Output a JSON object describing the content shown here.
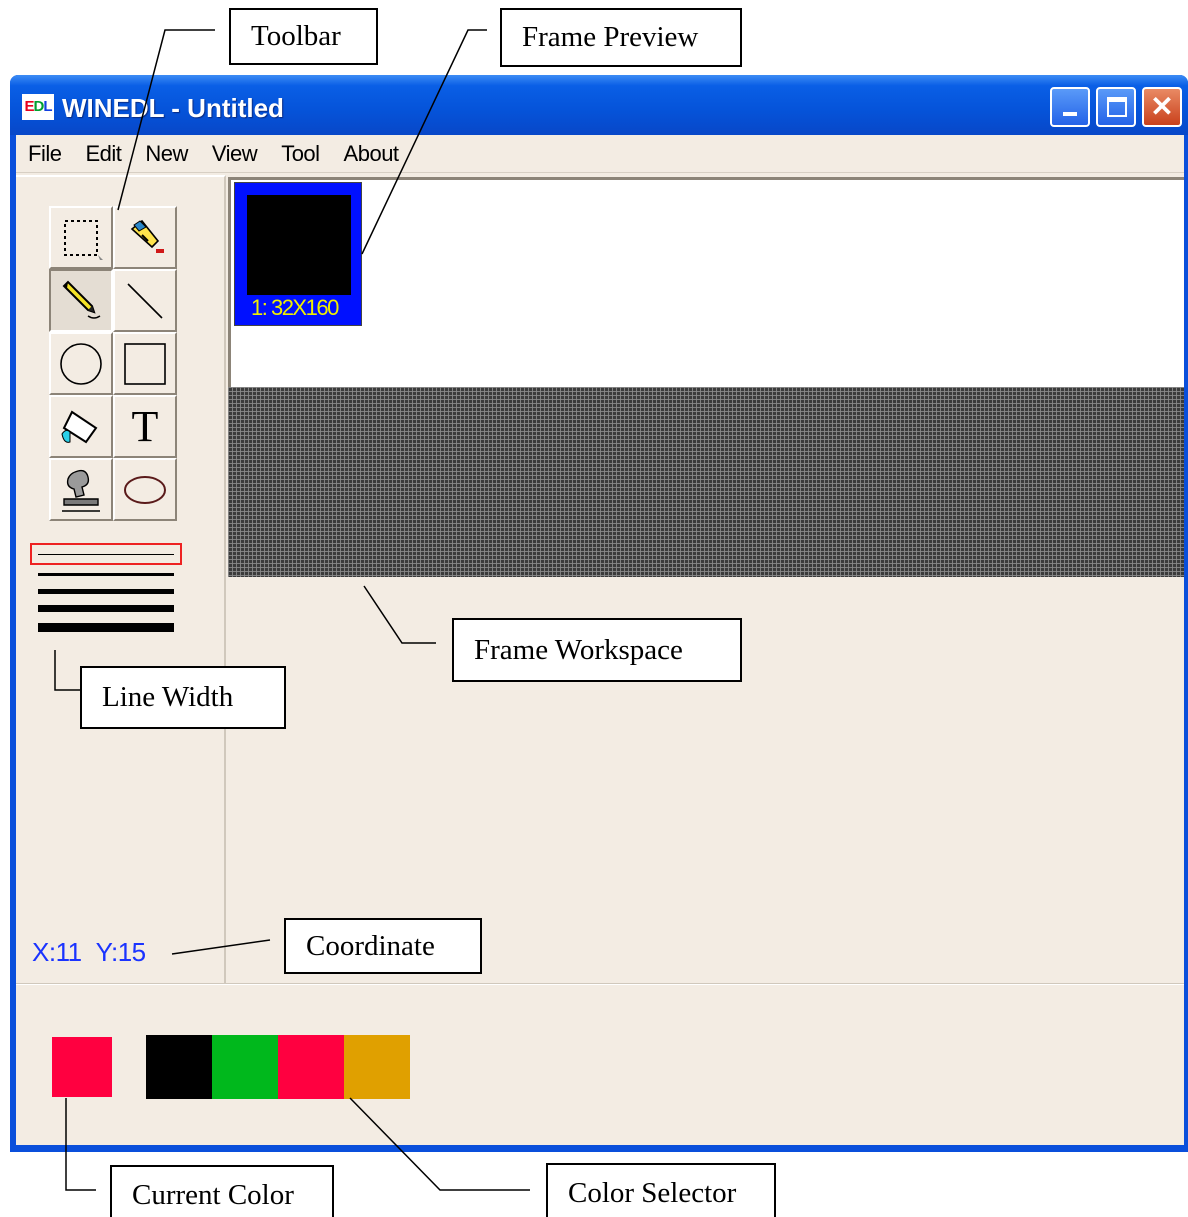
{
  "window": {
    "title": "WINEDL - Untitled",
    "icon_text": [
      "E",
      "D",
      "L"
    ]
  },
  "menu": [
    "File",
    "Edit",
    "New",
    "View",
    "Tool",
    "About"
  ],
  "tools": [
    {
      "name": "select-rect-tool",
      "icon": "dotted-rectangle"
    },
    {
      "name": "pick-color-tool",
      "icon": "dropper"
    },
    {
      "name": "pencil-tool",
      "icon": "pencil",
      "active": true
    },
    {
      "name": "line-tool",
      "icon": "diagonal-line"
    },
    {
      "name": "circle-tool",
      "icon": "circle"
    },
    {
      "name": "rectangle-tool",
      "icon": "rectangle"
    },
    {
      "name": "fill-tool",
      "icon": "paint-bucket"
    },
    {
      "name": "text-tool",
      "icon": "letter-T",
      "glyph": "T"
    },
    {
      "name": "stamp-tool",
      "icon": "stamp"
    },
    {
      "name": "ellipse-tool",
      "icon": "ellipse"
    }
  ],
  "frame": {
    "label": "1: 32X160"
  },
  "coordinate": {
    "x": "X:11",
    "y": "Y:15"
  },
  "current_color": "#ff0040",
  "palette": [
    "#000000",
    "#00b81c",
    "#ff0040",
    "#e0a000"
  ],
  "annotations": {
    "toolbar": "Toolbar",
    "frame_preview": "Frame Preview",
    "frame_workspace": "Frame Workspace",
    "line_width": "Line Width",
    "coordinate": "Coordinate",
    "current_color": "Current Color",
    "color_selector": "Color Selector"
  }
}
